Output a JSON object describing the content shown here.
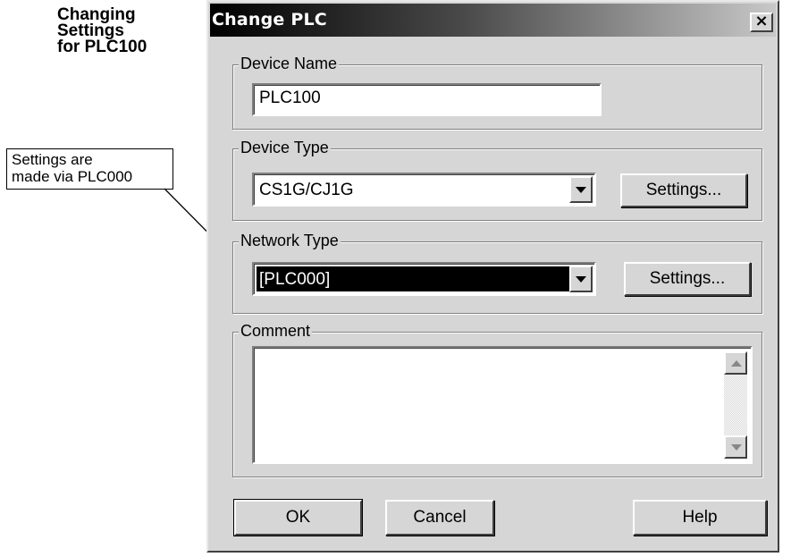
{
  "side_heading": [
    "Changing",
    "Settings",
    "for PLC100"
  ],
  "callout": [
    "Settings are",
    "made via PLC000"
  ],
  "dialog": {
    "title": "Change PLC",
    "close_symbol": "×",
    "device_name": {
      "label": "Device Name",
      "value": "PLC100"
    },
    "device_type": {
      "label": "Device Type",
      "value": "CS1G/CJ1G",
      "settings_label": "Settings..."
    },
    "network_type": {
      "label": "Network Type",
      "value": "[PLC000]",
      "settings_label": "Settings..."
    },
    "comment": {
      "label": "Comment",
      "value": ""
    },
    "buttons": {
      "ok": "OK",
      "cancel": "Cancel",
      "help": "Help"
    }
  },
  "colors": {
    "dialog_bg": "#d6d6d6",
    "title_start": "#000000",
    "title_end": "#c8c8c8",
    "selection": "#000000"
  }
}
